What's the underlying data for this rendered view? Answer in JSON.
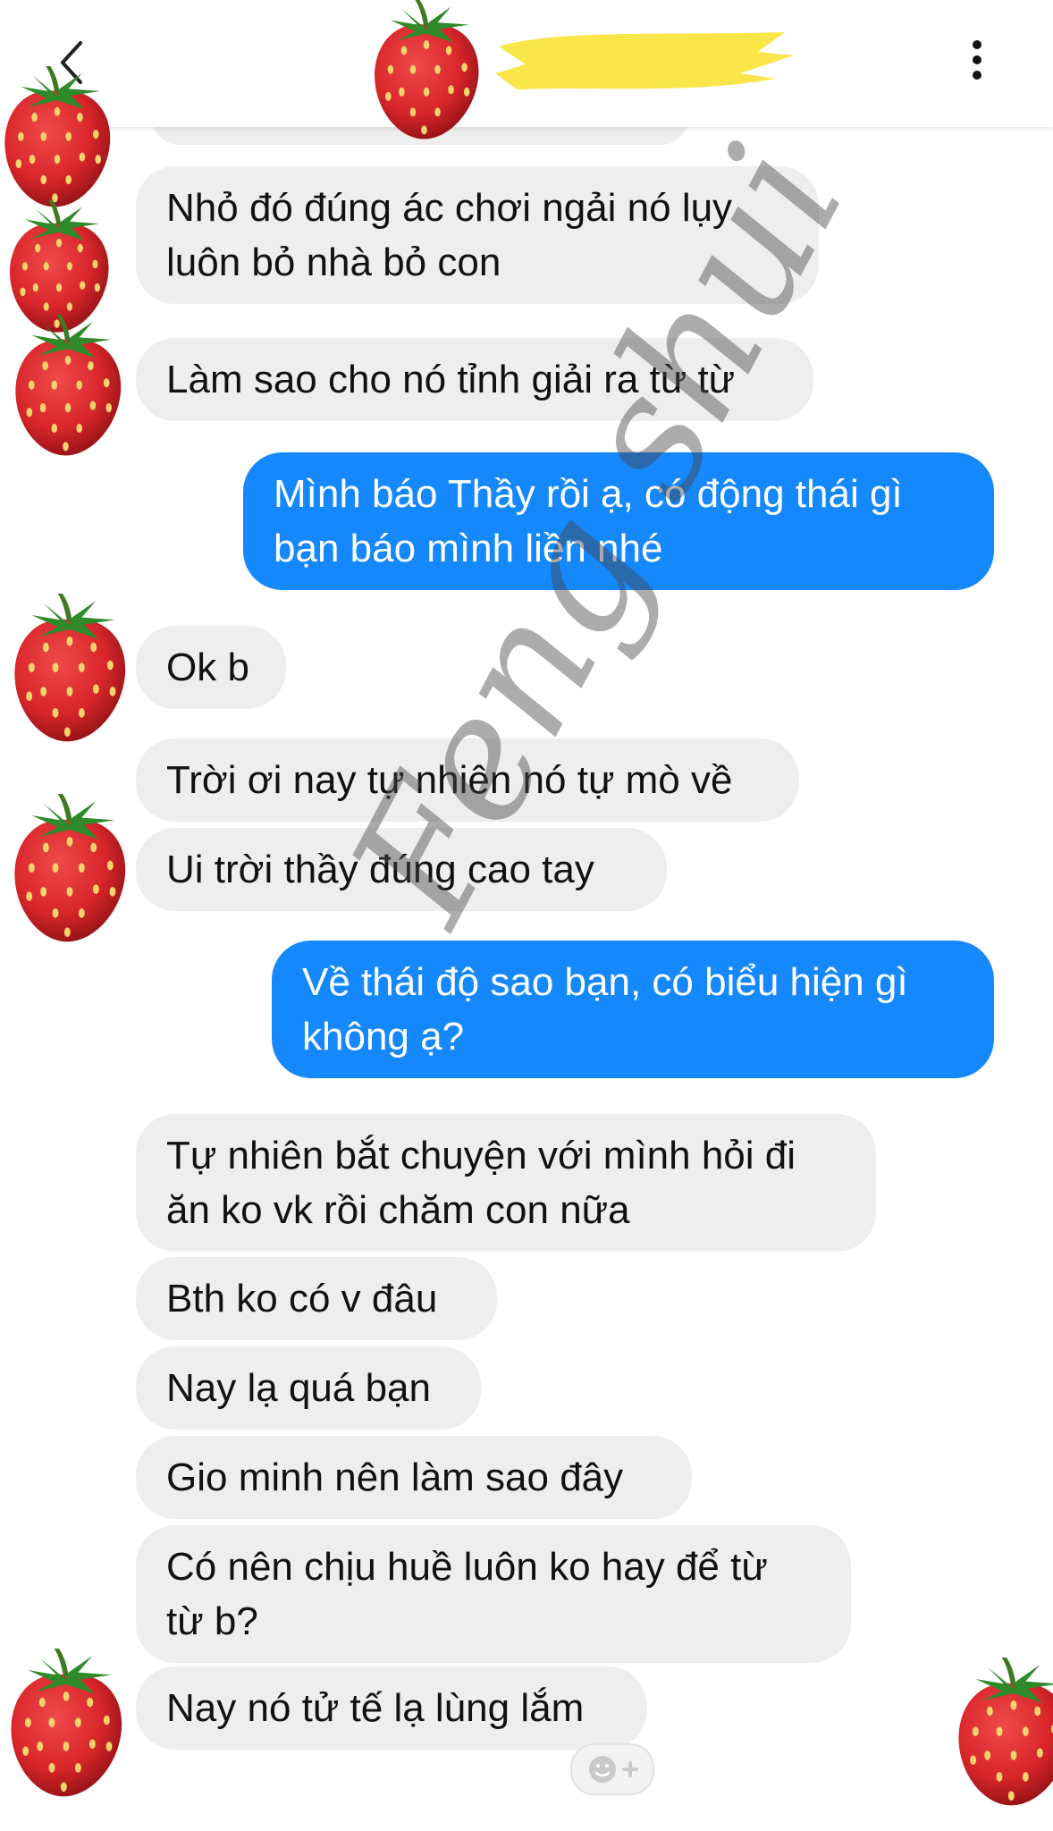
{
  "header": {
    "back_icon": "chevron-left-icon",
    "contact_name": "",
    "more_icon": "vertical-dots-icon"
  },
  "messages": [
    {
      "side": "in",
      "text": "Nhỏ đó đúng ác chơi ngải nó lụy\nluôn bỏ nhà bỏ con"
    },
    {
      "side": "in",
      "text": "Làm sao cho nó tỉnh giải ra từ từ"
    },
    {
      "side": "out",
      "text": "Mình báo Thầy rồi ạ, có động thái gì\nbạn báo mình liền nhé"
    },
    {
      "side": "in",
      "text": "Ok b"
    },
    {
      "side": "in",
      "text": "Trời ơi nay tự nhiên nó tự mò về"
    },
    {
      "side": "in",
      "text": "Ui trời thầy đúng cao tay"
    },
    {
      "side": "out",
      "text": "Về thái độ sao bạn, có biểu hiện gì\nkhông ạ?"
    },
    {
      "side": "in",
      "text": "Tự nhiên bắt chuyện với mình hỏi đi\năn ko vk rồi chăm con nữa"
    },
    {
      "side": "in",
      "text": "Bth ko có v đâu"
    },
    {
      "side": "in",
      "text": "Nay lạ quá bạn"
    },
    {
      "side": "in",
      "text": "Gio minh nên làm sao đây"
    },
    {
      "side": "in",
      "text": "Có nên chịu huề luôn ko hay để từ\ntừ b?"
    },
    {
      "side": "in",
      "text": "Nay nó tử tế lạ lùng lắm"
    }
  ],
  "watermark": "Feng shui",
  "colors": {
    "outgoing_bubble": "#1488fc",
    "incoming_bubble": "#eeeeee",
    "name_redaction": "#fbe64a",
    "strawberry": "#d8262b"
  },
  "overlay_icon": "strawberry-sticker",
  "react_icon": "add-reaction-icon"
}
